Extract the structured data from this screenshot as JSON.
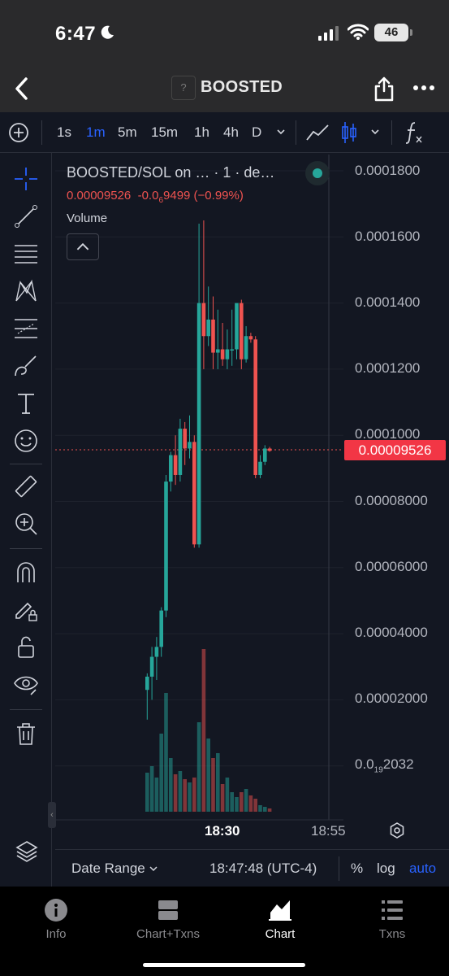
{
  "status": {
    "time": "6:47",
    "battery": "46"
  },
  "header": {
    "title": "BOOSTED",
    "logo_placeholder": "?"
  },
  "toolbar": {
    "intervals": [
      "1s",
      "1m",
      "5m",
      "15m",
      "1h",
      "4h",
      "D"
    ],
    "active_interval": "1m"
  },
  "legend": {
    "title": "BOOSTED/SOL on … · 1 · de…",
    "price": "0.00009526",
    "change_prefix": "-0.0",
    "change_sub": "6",
    "change_suffix": "9499 (−0.99%)",
    "volume_label": "Volume"
  },
  "price_axis": {
    "labels": [
      "0.0001800",
      "0.0001600",
      "0.0001400",
      "0.0001200",
      "0.0001000",
      "0.00008000",
      "0.00006000",
      "0.00004000",
      "0.00002000"
    ],
    "last_prefix": "0.0",
    "last_sub": "19",
    "last_suffix": "2032",
    "current_price": "0.00009526"
  },
  "time_axis": {
    "label_main": "18:30",
    "label_right": "18:55"
  },
  "bottom_bar": {
    "date_range": "Date Range",
    "clock": "18:47:48 (UTC-4)",
    "percent": "%",
    "log": "log",
    "auto": "auto"
  },
  "tabs": [
    {
      "label": "Info",
      "icon": "info-icon"
    },
    {
      "label": "Chart+Txns",
      "icon": "split-icon"
    },
    {
      "label": "Chart",
      "icon": "chart-icon",
      "active": true
    },
    {
      "label": "Txns",
      "icon": "list-icon"
    }
  ],
  "colors": {
    "up": "#26a69a",
    "down": "#ef5350",
    "accent": "#2962ff",
    "background": "#131722"
  },
  "chart_data": {
    "type": "candlestick",
    "price_axis_range": [
      0,
      0.00019
    ],
    "current_price": 9.526e-05,
    "candles": [
      {
        "o": 2.3e-05,
        "h": 2.8e-05,
        "l": 1.4e-05,
        "c": 2.7e-05
      },
      {
        "o": 2.7e-05,
        "h": 3.6e-05,
        "l": 2e-05,
        "c": 3.3e-05
      },
      {
        "o": 3.3e-05,
        "h": 3.9e-05,
        "l": 2.6e-05,
        "c": 3.6e-05
      },
      {
        "o": 3.6e-05,
        "h": 4.8e-05,
        "l": 3.3e-05,
        "c": 4.7e-05
      },
      {
        "o": 4.7e-05,
        "h": 8.8e-05,
        "l": 4.5e-05,
        "c": 8.6e-05
      },
      {
        "o": 8.6e-05,
        "h": 9.5e-05,
        "l": 8.3e-05,
        "c": 9.4e-05
      },
      {
        "o": 9.4e-05,
        "h": 0.0001,
        "l": 8.5e-05,
        "c": 8.8e-05
      },
      {
        "o": 8.8e-05,
        "h": 0.000105,
        "l": 8.6e-05,
        "c": 0.000102
      },
      {
        "o": 0.000102,
        "h": 0.000104,
        "l": 9.1e-05,
        "c": 9.6e-05
      },
      {
        "o": 9.6e-05,
        "h": 0.000106,
        "l": 9.3e-05,
        "c": 9.8e-05
      },
      {
        "o": 9.8e-05,
        "h": 0.0001,
        "l": 6.6e-05,
        "c": 6.7e-05
      },
      {
        "o": 6.7e-05,
        "h": 0.000164,
        "l": 6.6e-05,
        "c": 0.00014
      },
      {
        "o": 0.00014,
        "h": 0.000165,
        "l": 0.00012,
        "c": 0.00013
      },
      {
        "o": 0.00013,
        "h": 0.000145,
        "l": 0.000127,
        "c": 0.000135
      },
      {
        "o": 0.000135,
        "h": 0.000142,
        "l": 0.00012,
        "c": 0.000125
      },
      {
        "o": 0.000125,
        "h": 0.000138,
        "l": 0.00012,
        "c": 0.000126
      },
      {
        "o": 0.000126,
        "h": 0.000134,
        "l": 0.000121,
        "c": 0.000123
      },
      {
        "o": 0.000123,
        "h": 0.000132,
        "l": 0.00012,
        "c": 0.000126
      },
      {
        "o": 0.000126,
        "h": 0.000138,
        "l": 0.000121,
        "c": 0.000126
      },
      {
        "o": 0.000126,
        "h": 0.000135,
        "l": 0.000123,
        "c": 0.00014
      },
      {
        "o": 0.00014,
        "h": 0.000141,
        "l": 0.00012,
        "c": 0.000123
      },
      {
        "o": 0.000123,
        "h": 0.000133,
        "l": 0.000122,
        "c": 0.00013
      },
      {
        "o": 0.00013,
        "h": 0.000131,
        "l": 0.000128,
        "c": 0.000129
      },
      {
        "o": 0.000129,
        "h": 0.00013,
        "l": 8.7e-05,
        "c": 8.8e-05
      },
      {
        "o": 8.8e-05,
        "h": 9.4e-05,
        "l": 8.7e-05,
        "c": 9.2e-05
      },
      {
        "o": 9.2e-05,
        "h": 9.7e-05,
        "l": 9.1e-05,
        "c": 9.6e-05
      },
      {
        "o": 9.6e-05,
        "h": 9.65e-05,
        "l": 9.5e-05,
        "c": 9.53e-05
      }
    ],
    "volumes": [
      0.24,
      0.28,
      0.21,
      0.48,
      0.73,
      0.33,
      0.23,
      0.25,
      0.2,
      0.18,
      0.21,
      0.55,
      1.0,
      0.45,
      0.33,
      0.36,
      0.17,
      0.21,
      0.12,
      0.09,
      0.12,
      0.14,
      0.1,
      0.08,
      0.04,
      0.03,
      0.02
    ]
  }
}
